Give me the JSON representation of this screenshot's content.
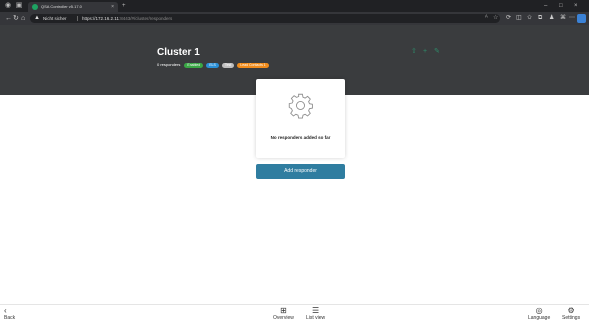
{
  "browser": {
    "tab_title": "QSA Controller v5.17.0",
    "new_tab": "+",
    "security_label": "Nicht sicher",
    "url_host": "https://172.16.2.11",
    "url_path": ":8443/#/cluster/responders",
    "window_controls": [
      "–",
      "□",
      "×"
    ]
  },
  "header": {
    "title": "Cluster 1",
    "responders": "0 responders",
    "badges": [
      {
        "label": "Enabled",
        "color": "#3aa845"
      },
      {
        "label": "ELS",
        "color": "#2a8fd6"
      },
      {
        "label": "Test",
        "color": "#bfbfbf"
      },
      {
        "label": "Lead Contacts 1",
        "color": "#f08c1c"
      }
    ]
  },
  "main": {
    "empty_message": "No responders added so far",
    "add_button": "Add responder"
  },
  "bottom_nav": {
    "back": "Back",
    "overview": "Overview",
    "list_view": "List view",
    "language": "Language",
    "settings": "Settings"
  },
  "colors": {
    "header_bg": "#3a3c3e",
    "accent": "#2f7da0",
    "header_icon": "#2e8c6a"
  }
}
